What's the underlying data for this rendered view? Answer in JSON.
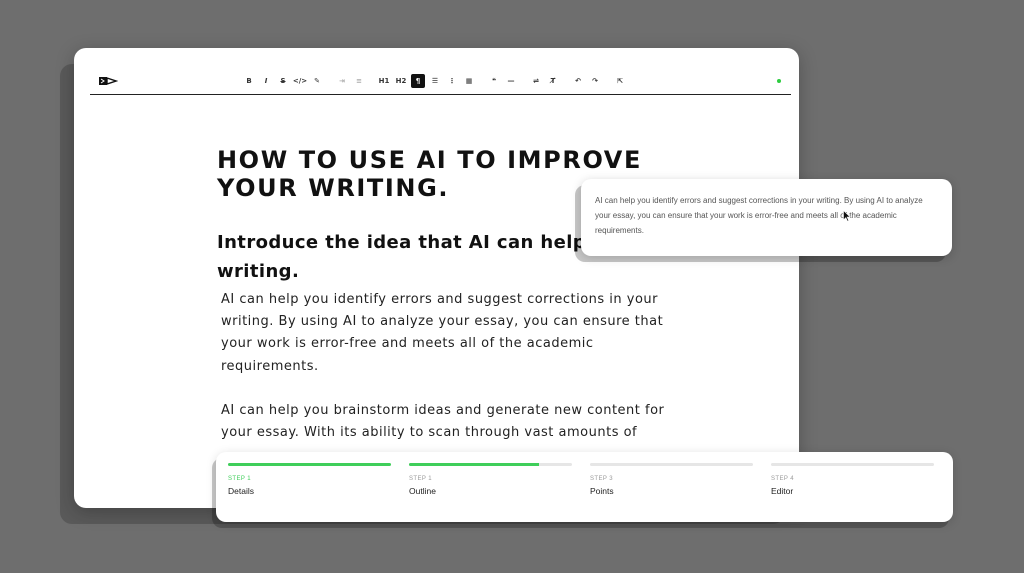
{
  "editor": {
    "toolbar": {
      "buttons": [
        {
          "id": "bold",
          "glyph": "B"
        },
        {
          "id": "italic",
          "glyph": "I"
        },
        {
          "id": "strike",
          "glyph": "S"
        },
        {
          "id": "code",
          "glyph": "</>"
        },
        {
          "id": "highlight",
          "glyph": "✎"
        },
        {
          "id": "indent",
          "glyph": "⇥"
        },
        {
          "id": "outdent",
          "glyph": "≡"
        },
        {
          "id": "h1",
          "glyph": "H1"
        },
        {
          "id": "h2",
          "glyph": "H2"
        },
        {
          "id": "paragraph",
          "glyph": "¶"
        },
        {
          "id": "bullet-list",
          "glyph": "☰"
        },
        {
          "id": "ordered-list",
          "glyph": "⋮"
        },
        {
          "id": "table",
          "glyph": "▦"
        },
        {
          "id": "quote",
          "glyph": "❝"
        },
        {
          "id": "hr",
          "glyph": "—"
        },
        {
          "id": "wrap",
          "glyph": "⇌"
        },
        {
          "id": "clear-format",
          "glyph": "T̸"
        },
        {
          "id": "undo",
          "glyph": "↶"
        },
        {
          "id": "redo",
          "glyph": "↷"
        },
        {
          "id": "export",
          "glyph": "⇱"
        }
      ],
      "status_color": "#2ecc40"
    },
    "title": "HOW TO USE AI TO IMPROVE YOUR WRITING.",
    "subtitle": "Introduce the idea that AI can help improve your writing.",
    "paragraphs": [
      "AI can help you identify errors and suggest corrections in your writing. By using AI to analyze your essay, you can ensure that your work is error-free and meets all of the academic requirements.",
      "AI can help you brainstorm ideas and generate new content for your essay. With its ability to scan through vast amounts of"
    ]
  },
  "tooltip": {
    "text": "AI can help you identify errors and suggest corrections in your writing. By using AI to analyze your essay, you can ensure that your work is error-free and meets all of the academic requirements."
  },
  "steps": [
    {
      "num": "STEP 1",
      "name": "Details",
      "progress": 1.0
    },
    {
      "num": "STEP 1",
      "name": "Outline",
      "progress": 0.8
    },
    {
      "num": "STEP 3",
      "name": "Points",
      "progress": 0.0
    },
    {
      "num": "STEP 4",
      "name": "Editor",
      "progress": 0.0
    }
  ],
  "colors": {
    "accent": "#3fce5a",
    "background": "#6e6e6e"
  }
}
